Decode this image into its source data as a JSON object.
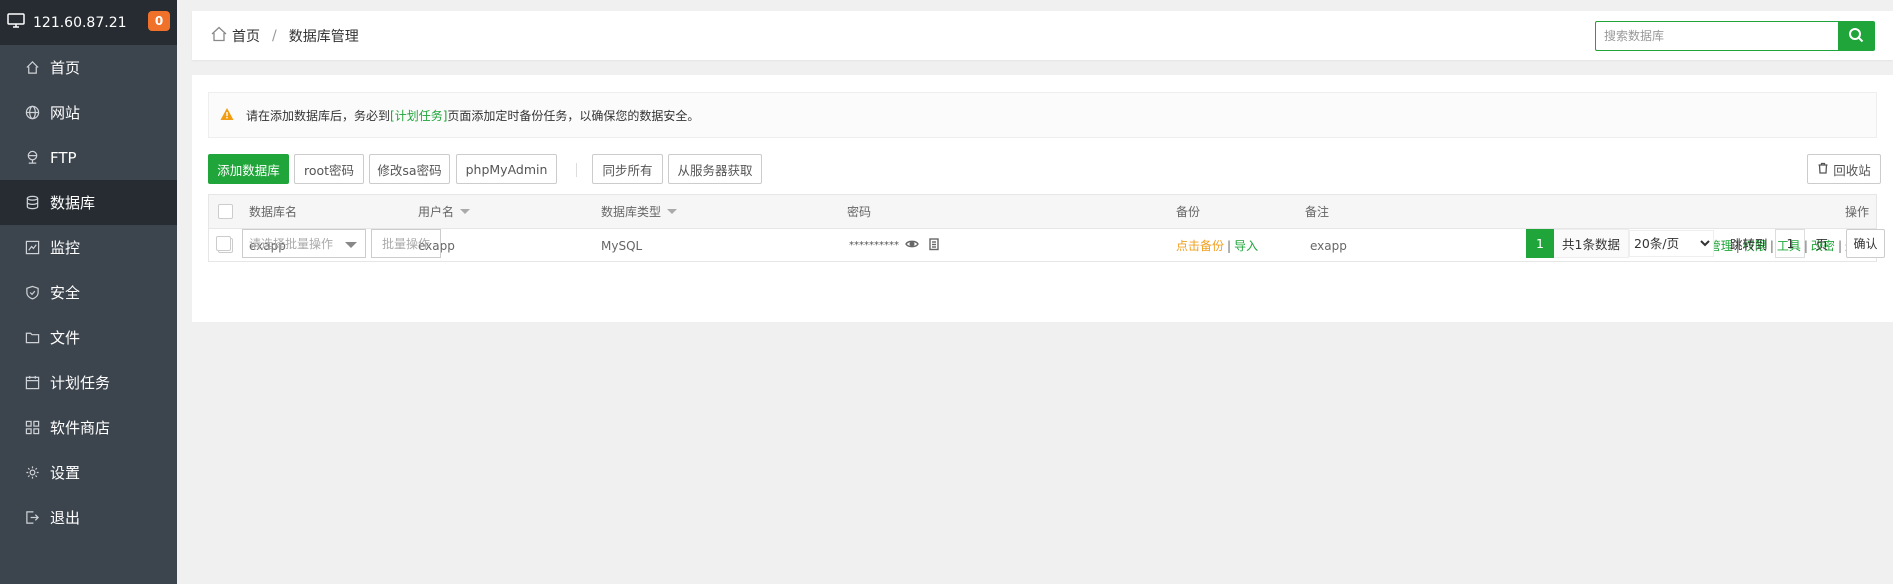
{
  "sidebar": {
    "host": "121.60.87.21",
    "badge": "0",
    "items": [
      {
        "label": "首页",
        "icon": "home-icon"
      },
      {
        "label": "网站",
        "icon": "globe-icon"
      },
      {
        "label": "FTP",
        "icon": "ftp-icon"
      },
      {
        "label": "数据库",
        "icon": "database-icon"
      },
      {
        "label": "监控",
        "icon": "monitor-icon"
      },
      {
        "label": "安全",
        "icon": "shield-icon"
      },
      {
        "label": "文件",
        "icon": "folder-icon"
      },
      {
        "label": "计划任务",
        "icon": "calendar-icon"
      },
      {
        "label": "软件商店",
        "icon": "grid-icon"
      },
      {
        "label": "设置",
        "icon": "gear-icon"
      },
      {
        "label": "退出",
        "icon": "logout-icon"
      }
    ],
    "active_index": 3
  },
  "header": {
    "breadcrumb_home": "首页",
    "breadcrumb_sep": "/",
    "breadcrumb_current": "数据库管理",
    "search_placeholder": "搜索数据库"
  },
  "alert": {
    "before": "请在添加数据库后，务必到",
    "link": "[计划任务]",
    "after": "页面添加定时备份任务，以确保您的数据安全。"
  },
  "toolbar": {
    "add_db": "添加数据库",
    "root_pw": "root密码",
    "sa_pw": "修改sa密码",
    "phpmyadmin": "phpMyAdmin",
    "sync_all": "同步所有",
    "from_server": "从服务器获取",
    "recycle": "回收站"
  },
  "table": {
    "headers": {
      "name": "数据库名",
      "user": "用户名",
      "type": "数据库类型",
      "password": "密码",
      "backup": "备份",
      "note": "备注",
      "ops": "操作"
    },
    "rows": [
      {
        "name": "exapp",
        "user": "exapp",
        "type": "MySQL",
        "password_mask": "**********",
        "backup_action": "点击备份",
        "import_action": "导入",
        "note": "exapp",
        "ops": [
          "管理",
          "权限",
          "工具",
          "改密",
          "删除"
        ]
      }
    ]
  },
  "footer": {
    "batch_placeholder": "请选择批量操作",
    "batch_button": "批量操作",
    "current_page": "1",
    "total": "共1条数据",
    "per_page": "20条/页",
    "goto_label": "跳转到",
    "goto_value": "1",
    "page_unit": "页",
    "confirm": "确认"
  },
  "colors": {
    "accent": "#20a53a",
    "sidebar_bg": "#3c444d",
    "sidebar_active": "#262c32",
    "badge": "#f0712a",
    "backup_link": "#f0a020"
  }
}
